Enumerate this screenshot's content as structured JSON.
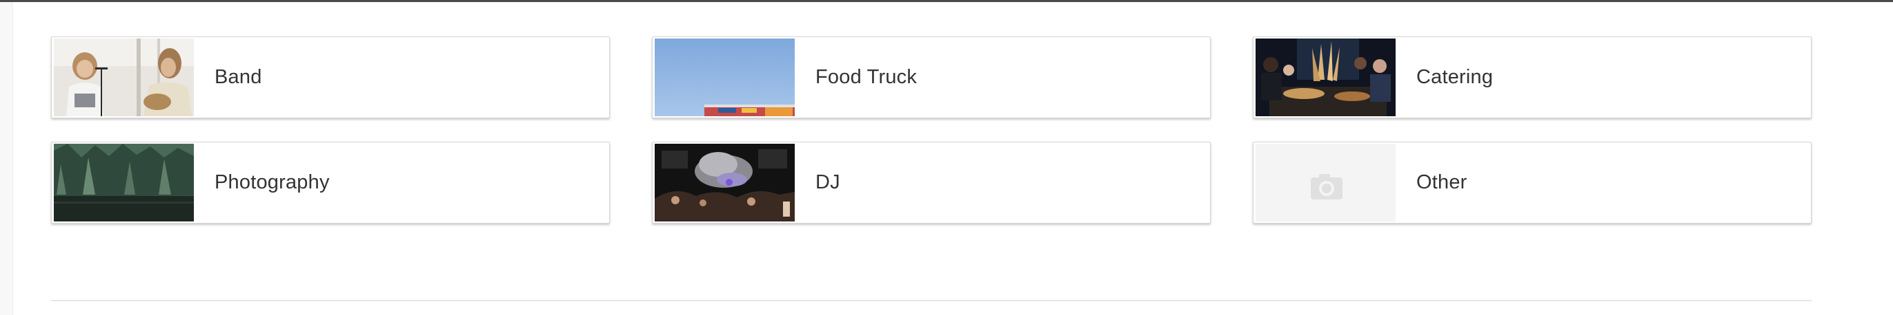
{
  "categories": [
    {
      "label": "Band",
      "thumb": "band-photo"
    },
    {
      "label": "Food Truck",
      "thumb": "food-truck-photo"
    },
    {
      "label": "Catering",
      "thumb": "catering-photo"
    },
    {
      "label": "Photography",
      "thumb": "photography-photo"
    },
    {
      "label": "DJ",
      "thumb": "dj-photo"
    },
    {
      "label": "Other",
      "thumb": "camera-icon"
    }
  ]
}
